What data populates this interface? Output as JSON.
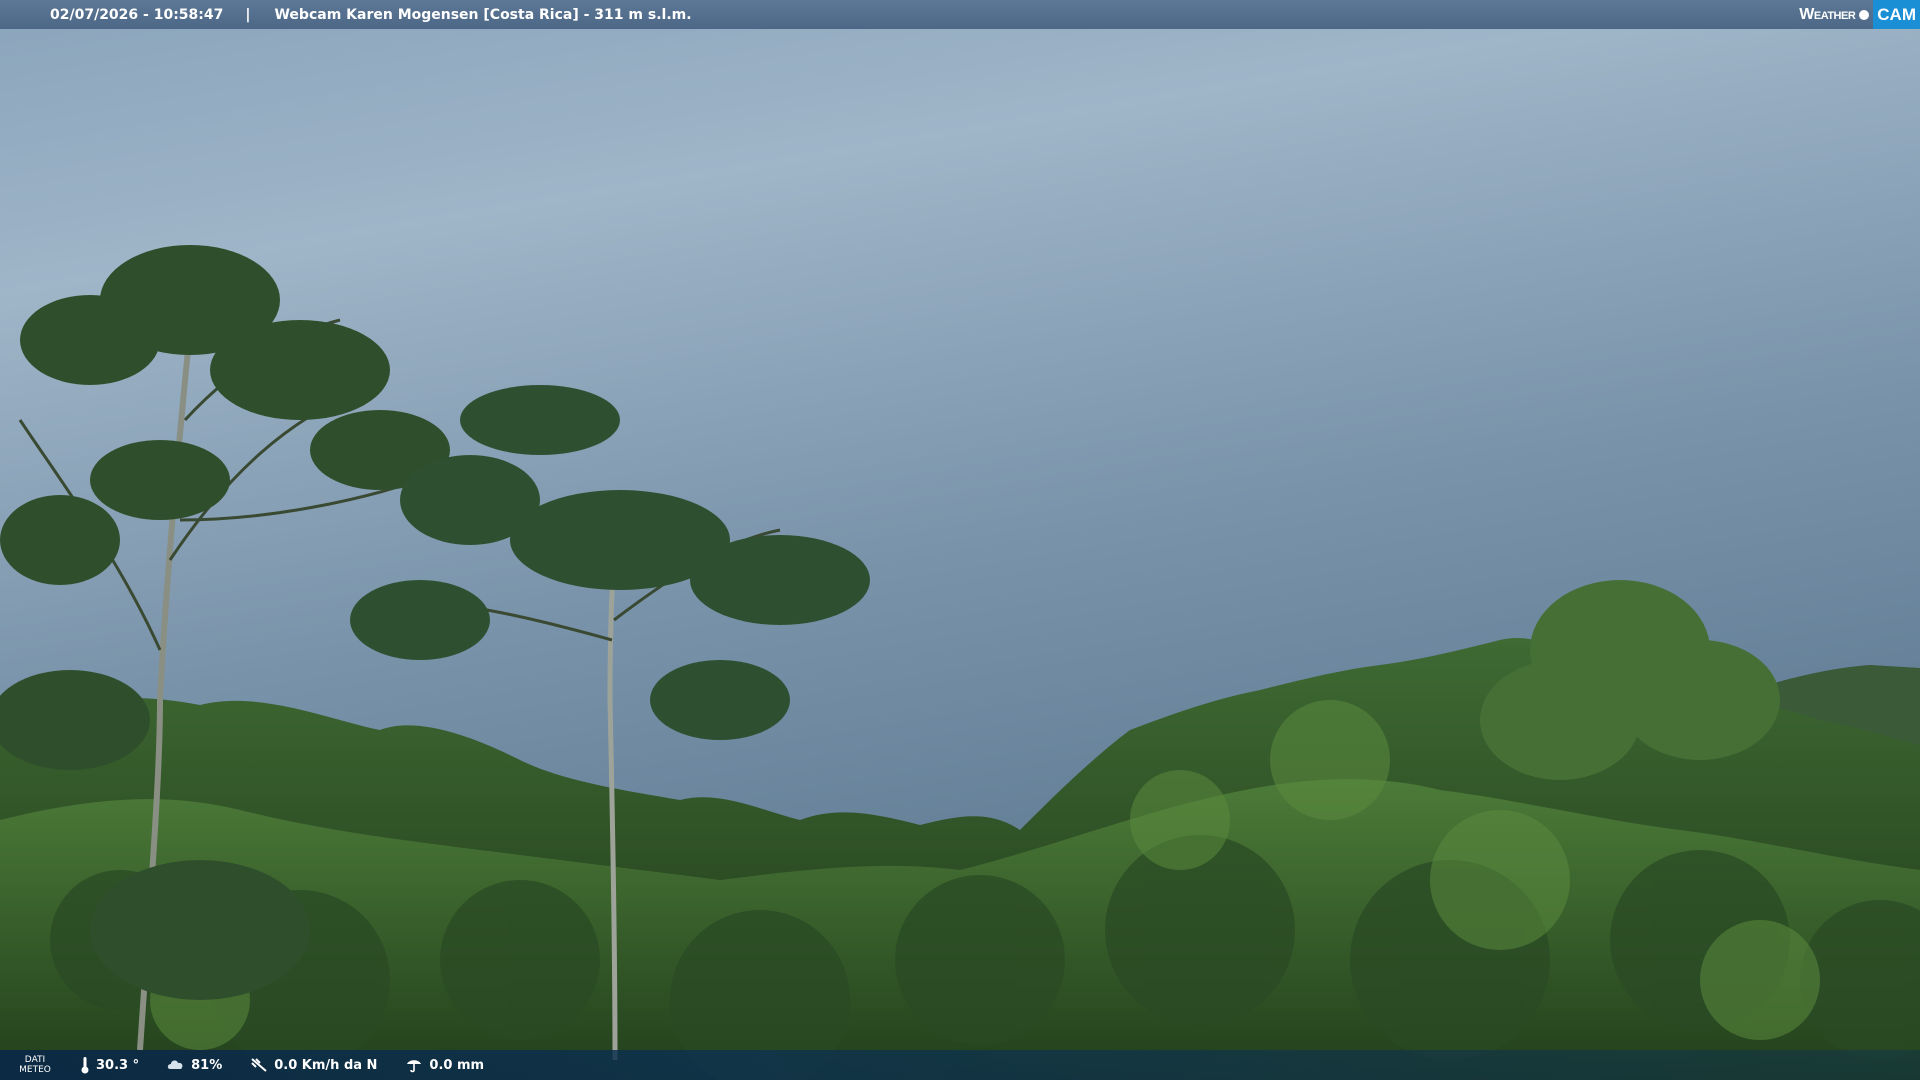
{
  "header": {
    "datetime": "02/07/2026 - 10:58:47",
    "separator": "|",
    "title": "Webcam Karen Mogensen [Costa Rica] - 311 m s.l.m."
  },
  "logo": {
    "part1": "Weather",
    "part2": "CAM"
  },
  "footer": {
    "label_line1": "DATI",
    "label_line2": "METEO",
    "temperature": "30.3 °",
    "humidity": "81%",
    "wind": "0.0 Km/h da N",
    "rain": "0.0 mm"
  },
  "colors": {
    "sky_top": "#8fa8be",
    "sky_bottom": "#5f7c94",
    "foliage_dark": "#1f3a1c",
    "foliage_light": "#4e7a34",
    "logo_accent": "#1b8fd6"
  },
  "icons": [
    "thermometer-icon",
    "humidity-icon",
    "wind-icon",
    "rain-icon"
  ]
}
